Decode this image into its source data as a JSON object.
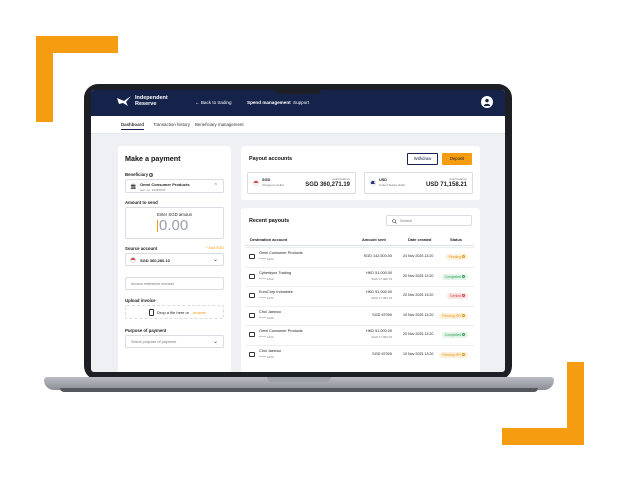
{
  "nav": {
    "brand_line1": "Independent",
    "brand_line2": "Reserve",
    "back": "← Back to trading",
    "spend": "Spend management",
    "support": "Support"
  },
  "tabs": [
    "Dashboard",
    "Transaction history",
    "Beneficiary management"
  ],
  "make_payment": {
    "title": "Make a payment",
    "beneficiary_label": "Beneficiary",
    "beneficiary_name": "Omni Consumer Products",
    "beneficiary_sub": "Acc. no. 12345678",
    "amount_label": "Amount to send",
    "amount_caption": "Enter SGD amoun",
    "amount_value": "0.00",
    "source_label": "Source account",
    "add_sgd": "+ Add SGD",
    "source_value": "SGD 360,280.10",
    "invoice_placeholder": "Invoice reference number",
    "upload_label": "Upload invoice",
    "drop_text": "Drop a file here or",
    "browse": "browse",
    "purpose_label": "Purpose of payment",
    "purpose_placeholder": "Select purpose of payment"
  },
  "payout_accounts": {
    "title": "Payout accounts",
    "withdraw": "Withdraw",
    "deposit": "Deposit",
    "accounts": [
      {
        "code": "SGD",
        "name": "Singapore dollar",
        "avail": "Avail balance",
        "balance": "SGD 360,271.19"
      },
      {
        "code": "USD",
        "name": "United States dollar",
        "avail": "Avail balance",
        "balance": "USD 71,158.21"
      }
    ]
  },
  "recent_payouts": {
    "title": "Recent payouts",
    "search_placeholder": "Search",
    "headers": [
      "Destination account",
      "Amount sent",
      "Date created",
      "Status"
    ],
    "rows": [
      {
        "name": "Omni Consumer Products",
        "acc": "****** 1234",
        "amount": "SGD 142,500.00",
        "amount2": "",
        "date": "24 Nov 2025 13:20",
        "status": "Pending"
      },
      {
        "name": "Cyberdyne Trading",
        "acc": "****** 1234",
        "amount": "HKD 51,000.00",
        "amount2": "SGD 17,000.79",
        "date": "20 Nov 2025 13:20",
        "status": "Completed"
      },
      {
        "name": "EuroCorp Industries",
        "acc": "****** 1234",
        "amount": "HKD 51,000.00",
        "amount2": "SGD 17,000.79",
        "date": "20 Nov 2025 13:20",
        "status": "Denied"
      },
      {
        "name": "Choi Jaewoo",
        "acc": "****** 1234",
        "amount": "SGD 67000",
        "amount2": "",
        "date": "19 Nov 2025 13:20",
        "status": "Pending RFI"
      },
      {
        "name": "Omni Consumer Products",
        "acc": "****** 1234",
        "amount": "HKD 51,000.00",
        "amount2": "SGD 17,000.79",
        "date": "20 Nov 2025 13:20",
        "status": "Completed"
      },
      {
        "name": "Choi Jaewoo",
        "acc": "****** 1234",
        "amount": "SGD 67000",
        "amount2": "",
        "date": "19 Nov 2025 13:20",
        "status": "Pending RFI"
      }
    ]
  },
  "colors": {
    "accent": "#f59c10",
    "navy": "#15234a",
    "pending": "#e69412",
    "completed": "#2e9d55",
    "denied": "#d64040"
  }
}
